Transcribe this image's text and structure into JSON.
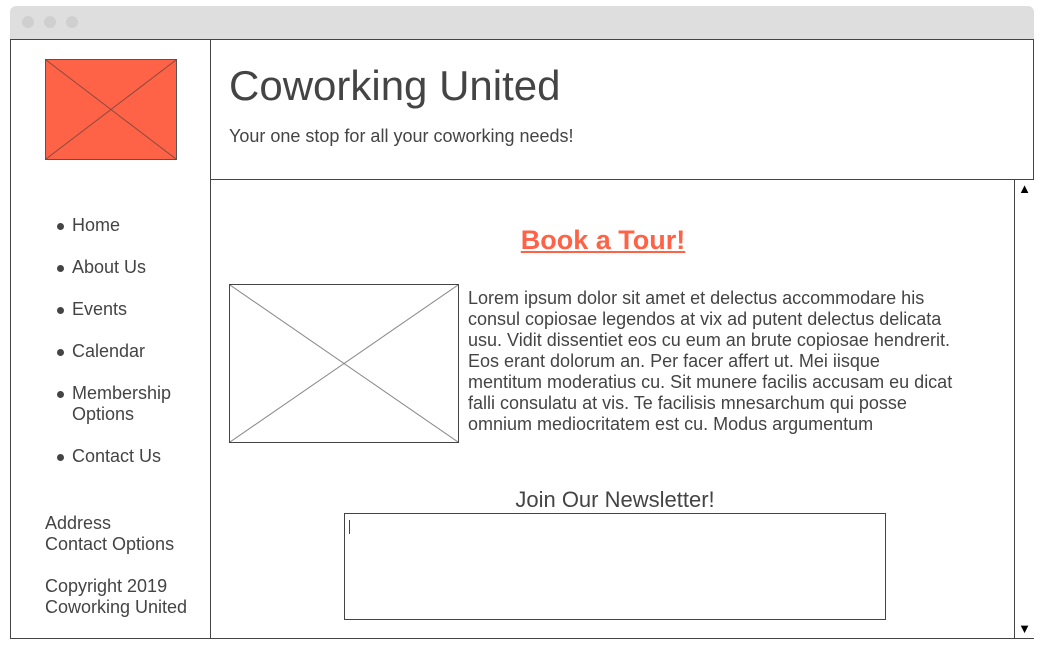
{
  "site": {
    "title": "Coworking United",
    "tagline": "Your one stop for all your coworking needs!"
  },
  "nav": {
    "items": [
      {
        "label": "Home"
      },
      {
        "label": "About Us"
      },
      {
        "label": "Events"
      },
      {
        "label": "Calendar"
      },
      {
        "label": "Membership Options"
      },
      {
        "label": "Contact Us"
      }
    ]
  },
  "footer": {
    "address": "Address",
    "contact_options": "Contact Options",
    "copyright": "Copyright 2019 Coworking United"
  },
  "main": {
    "cta_label": "Book a Tour!",
    "body_text": "Lorem ipsum dolor sit amet et delectus accommodare his consul copiosae legendos at vix ad putent delectus delicata usu. Vidit dissentiet eos cu eum an brute copiosae hendrerit. Eos erant dolorum an. Per facer affert ut. Mei iisque mentitum moderatius cu. Sit munere facilis accusam eu dicat falli consulatu at vis. Te facilisis mnesarchum qui posse omnium mediocritatem est cu. Modus argumentum",
    "newsletter_label": "Join Our Newsletter!",
    "newsletter_value": ""
  },
  "icons": {
    "logo": "image-placeholder-icon",
    "photo": "image-placeholder-icon",
    "scroll_up": "▲",
    "scroll_down": "▼"
  },
  "colors": {
    "accent": "#ff6347",
    "text": "#444444",
    "border": "#444444",
    "titlebar": "#dedede"
  }
}
